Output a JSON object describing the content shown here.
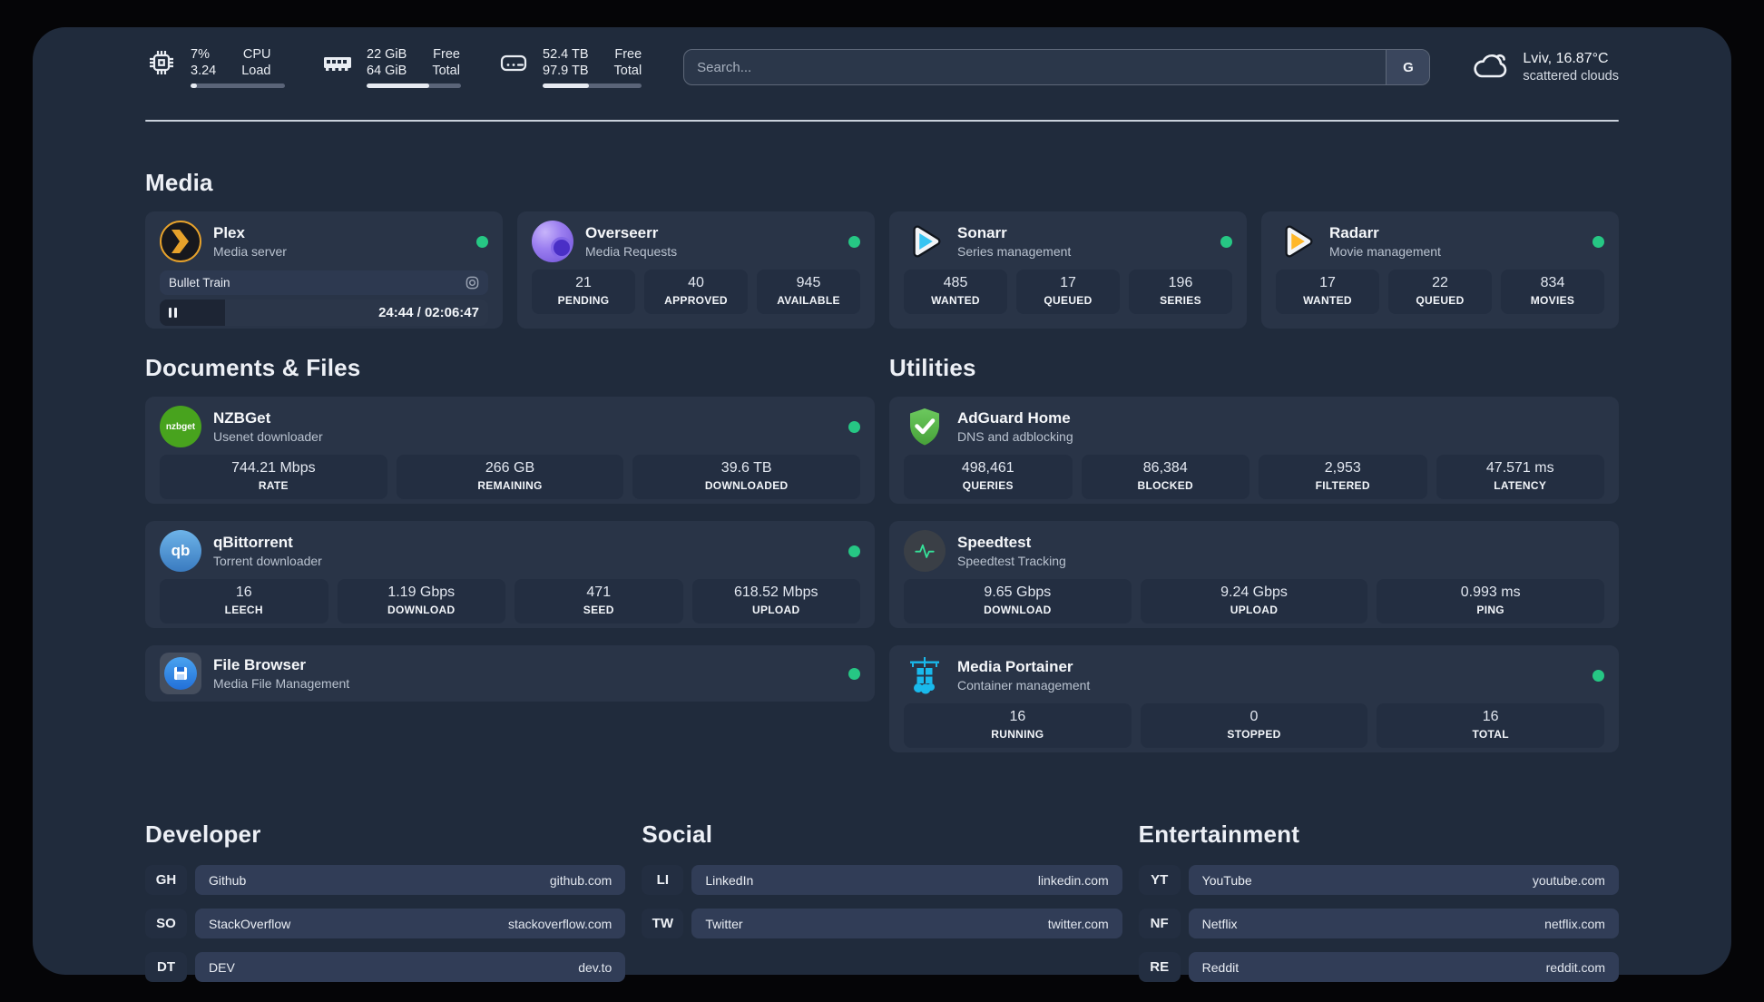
{
  "colors": {
    "status_online": "#26c784",
    "accent_plex": "#e7a22b",
    "accent_sonarr": "#37c4f2",
    "accent_radarr": "#ffb728"
  },
  "top_bar": {
    "system_stats": [
      {
        "icon": "cpu-icon",
        "values": [
          "7%",
          "3.24"
        ],
        "labels": [
          "CPU",
          "Load"
        ],
        "progress_pct": 7
      },
      {
        "icon": "memory-icon",
        "values": [
          "22 GiB",
          "64 GiB"
        ],
        "labels": [
          "Free",
          "Total"
        ],
        "progress_pct": 66
      },
      {
        "icon": "disk-icon",
        "values": [
          "52.4 TB",
          "97.9 TB"
        ],
        "labels": [
          "Free",
          "Total"
        ],
        "progress_pct": 47
      }
    ],
    "search": {
      "placeholder": "Search...",
      "engine_button_label": "G"
    },
    "weather": {
      "icon": "cloud-icon",
      "location_temperature": "Lviv, 16.87°C",
      "condition": "scattered clouds"
    }
  },
  "sections": {
    "media": {
      "title": "Media",
      "apps": [
        {
          "name": "Plex",
          "description": "Media server",
          "icon": "plex-icon",
          "status": "online",
          "now_playing": {
            "title": "Bullet Train",
            "time": "24:44 / 02:06:47",
            "progress_pct": 20
          }
        },
        {
          "name": "Overseerr",
          "description": "Media Requests",
          "icon": "overseerr-icon",
          "status": "online",
          "stats": [
            {
              "value": "21",
              "label": "PENDING"
            },
            {
              "value": "40",
              "label": "APPROVED"
            },
            {
              "value": "945",
              "label": "AVAILABLE"
            }
          ]
        },
        {
          "name": "Sonarr",
          "description": "Series management",
          "icon": "sonarr-icon",
          "status": "online",
          "stats": [
            {
              "value": "485",
              "label": "WANTED"
            },
            {
              "value": "17",
              "label": "QUEUED"
            },
            {
              "value": "196",
              "label": "SERIES"
            }
          ]
        },
        {
          "name": "Radarr",
          "description": "Movie management",
          "icon": "radarr-icon",
          "status": "online",
          "stats": [
            {
              "value": "17",
              "label": "WANTED"
            },
            {
              "value": "22",
              "label": "QUEUED"
            },
            {
              "value": "834",
              "label": "MOVIES"
            }
          ]
        }
      ]
    },
    "documents": {
      "title": "Documents & Files",
      "apps": [
        {
          "name": "NZBGet",
          "description": "Usenet downloader",
          "icon": "nzbget-icon",
          "status": "online",
          "stats": [
            {
              "value": "744.21 Mbps",
              "label": "RATE"
            },
            {
              "value": "266 GB",
              "label": "REMAINING"
            },
            {
              "value": "39.6 TB",
              "label": "DOWNLOADED"
            }
          ]
        },
        {
          "name": "qBittorrent",
          "description": "Torrent downloader",
          "icon": "qbittorrent-icon",
          "status": "online",
          "stats": [
            {
              "value": "16",
              "label": "LEECH"
            },
            {
              "value": "1.19 Gbps",
              "label": "DOWNLOAD"
            },
            {
              "value": "471",
              "label": "SEED"
            },
            {
              "value": "618.52 Mbps",
              "label": "UPLOAD"
            }
          ]
        },
        {
          "name": "File Browser",
          "description": "Media File Management",
          "icon": "filebrowser-icon",
          "status": "online"
        }
      ]
    },
    "utilities": {
      "title": "Utilities",
      "apps": [
        {
          "name": "AdGuard Home",
          "description": "DNS and adblocking",
          "icon": "adguard-icon",
          "stats": [
            {
              "value": "498,461",
              "label": "QUERIES"
            },
            {
              "value": "86,384",
              "label": "BLOCKED"
            },
            {
              "value": "2,953",
              "label": "FILTERED"
            },
            {
              "value": "47.571 ms",
              "label": "LATENCY"
            }
          ]
        },
        {
          "name": "Speedtest",
          "description": "Speedtest Tracking",
          "icon": "speedtest-icon",
          "stats": [
            {
              "value": "9.65 Gbps",
              "label": "DOWNLOAD"
            },
            {
              "value": "9.24 Gbps",
              "label": "UPLOAD"
            },
            {
              "value": "0.993 ms",
              "label": "PING"
            }
          ]
        },
        {
          "name": "Media Portainer",
          "description": "Container management",
          "icon": "portainer-icon",
          "status": "online",
          "stats": [
            {
              "value": "16",
              "label": "RUNNING"
            },
            {
              "value": "0",
              "label": "STOPPED"
            },
            {
              "value": "16",
              "label": "TOTAL"
            }
          ]
        }
      ]
    },
    "bookmarks": [
      {
        "title": "Developer",
        "links": [
          {
            "abbr": "GH",
            "name": "Github",
            "domain": "github.com"
          },
          {
            "abbr": "SO",
            "name": "StackOverflow",
            "domain": "stackoverflow.com"
          },
          {
            "abbr": "DT",
            "name": "DEV",
            "domain": "dev.to"
          }
        ]
      },
      {
        "title": "Social",
        "links": [
          {
            "abbr": "LI",
            "name": "LinkedIn",
            "domain": "linkedin.com"
          },
          {
            "abbr": "TW",
            "name": "Twitter",
            "domain": "twitter.com"
          }
        ]
      },
      {
        "title": "Entertainment",
        "links": [
          {
            "abbr": "YT",
            "name": "YouTube",
            "domain": "youtube.com"
          },
          {
            "abbr": "NF",
            "name": "Netflix",
            "domain": "netflix.com"
          },
          {
            "abbr": "RE",
            "name": "Reddit",
            "domain": "reddit.com"
          }
        ]
      }
    ]
  }
}
